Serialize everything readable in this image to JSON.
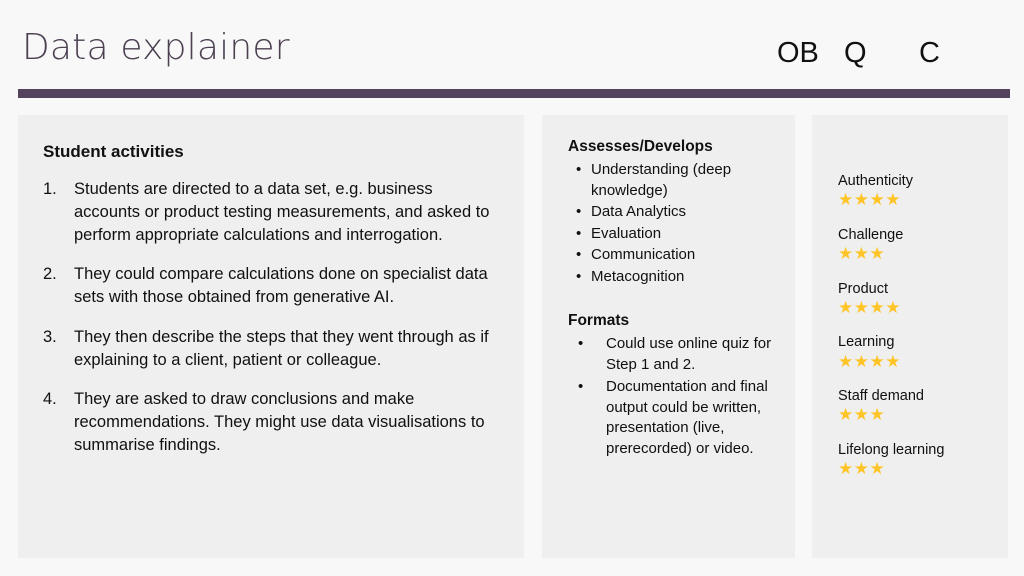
{
  "header": {
    "title": "Data explainer",
    "codes": [
      {
        "name": "ob",
        "label": "OB"
      },
      {
        "name": "q",
        "label": "Q"
      },
      {
        "name": "c",
        "label": "C"
      }
    ],
    "rule_color": "#53435c",
    "title_color": "#4b3f50"
  },
  "activities": {
    "heading": "Student activities",
    "items": [
      {
        "num": "1.",
        "text": "Students are directed to a data set, e.g. business accounts or product testing measurements, and asked to perform appropriate calculations and interrogation."
      },
      {
        "num": "2.",
        "text": "They could compare calculations done on specialist data sets with those obtained from generative AI."
      },
      {
        "num": "3.",
        "text": "They then describe the steps that they went through as if explaining to a client, patient or colleague."
      },
      {
        "num": "4.",
        "text": "They are asked to draw conclusions and make recommendations. They might use data visualisations to summarise findings."
      }
    ]
  },
  "assessment": {
    "assesses_heading": "Assesses/Develops",
    "assesses_items": [
      "Understanding (deep knowledge)",
      "Data Analytics",
      "Evaluation",
      "Communication",
      "Metacognition"
    ],
    "formats_heading": "Formats",
    "formats_items": [
      "Could use online quiz for Step 1 and 2.",
      "Documentation and final output could be written, presentation (live, prerecorded) or video."
    ],
    "bullet_glyph": "•"
  },
  "ratings": {
    "star_color": "#ffc528",
    "star_glyph": "★",
    "max": 5,
    "items": [
      {
        "label": "Authenticity",
        "stars": 4,
        "stars_text": "★★★★"
      },
      {
        "label": "Challenge",
        "stars": 3,
        "stars_text": "★★★"
      },
      {
        "label": "Product",
        "stars": 4,
        "stars_text": "★★★★"
      },
      {
        "label": "Learning",
        "stars": 4,
        "stars_text": "★★★★"
      },
      {
        "label": "Staff demand",
        "stars": 3,
        "stars_text": "★★★"
      },
      {
        "label": "Lifelong learning",
        "stars": 3,
        "stars_text": "★★★"
      }
    ]
  }
}
